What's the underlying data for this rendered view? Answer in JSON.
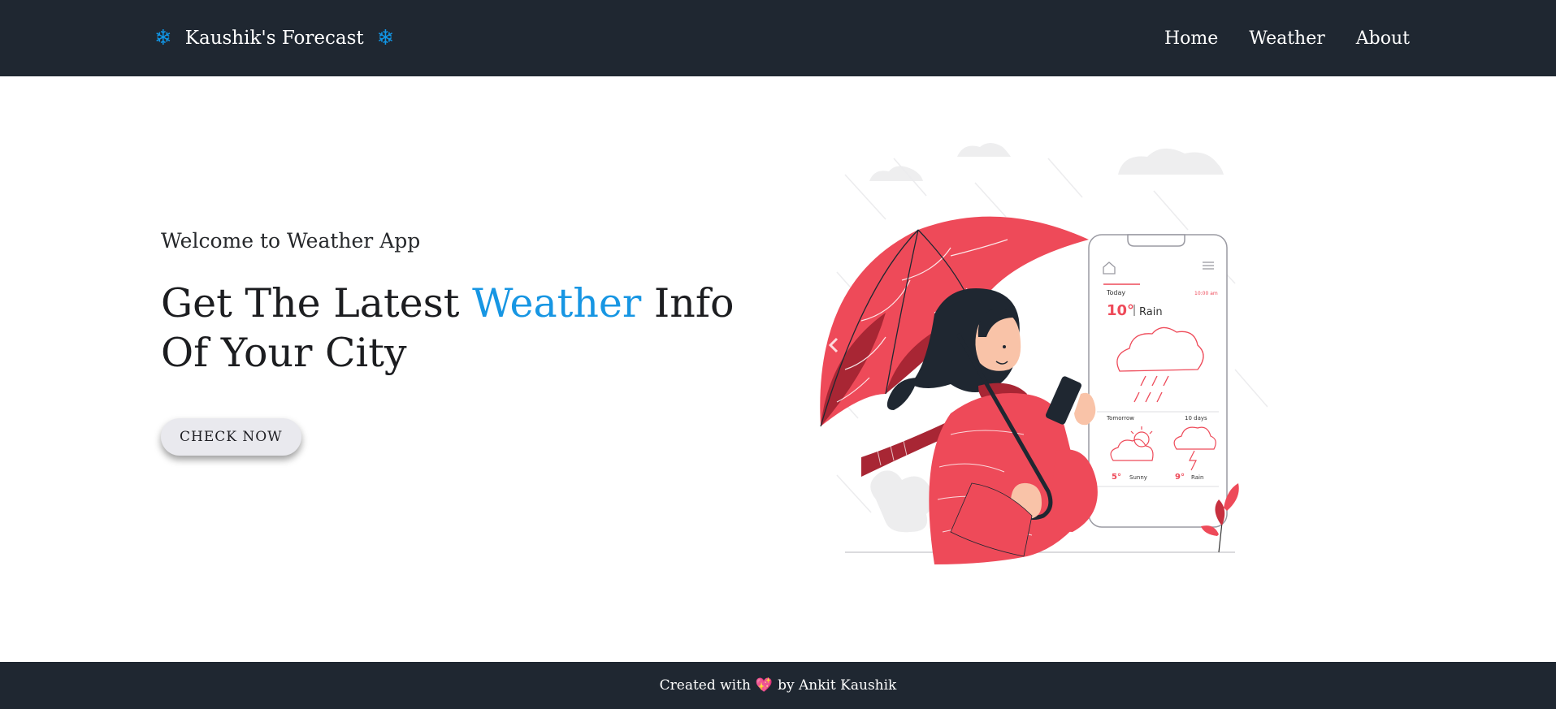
{
  "navbar": {
    "brand_title": "Kaushik's Forecast",
    "brand_icon": "snowflake-icon",
    "links": [
      "Home",
      "Weather",
      "About"
    ]
  },
  "hero": {
    "welcome": "Welcome to Weather App",
    "headline_part1": "Get The Latest ",
    "headline_accent": "Weather",
    "headline_part2": " Info Of Your City",
    "cta_label": "CHECK NOW"
  },
  "illustration": {
    "phone": {
      "today_label": "Today",
      "time": "10:00 am",
      "temp": "10°",
      "condition": "Rain",
      "tomorrow_label": "Tomorrow",
      "tomorrow_temp": "5°",
      "tomorrow_condition": "Sunny",
      "days_label": "10 days",
      "days_temp": "9°",
      "days_condition": "Rain"
    }
  },
  "footer": {
    "prefix": "Created with",
    "suffix": "by Ankit Kaushik",
    "heart_icon": "heart-icon"
  },
  "colors": {
    "navbar_bg": "#1f2731",
    "accent_blue": "#1796e3",
    "illustration_red": "#ee4a59",
    "dark_red": "#a82634"
  }
}
